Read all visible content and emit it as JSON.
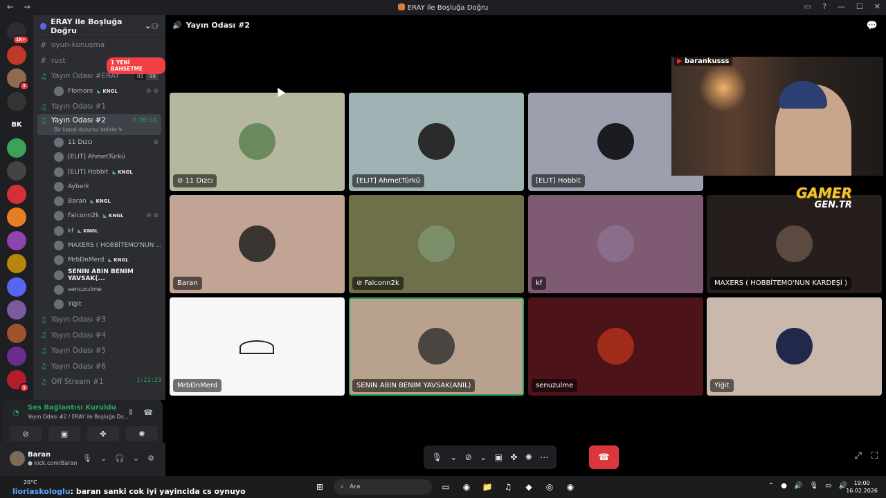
{
  "window": {
    "title": "ERAY ile Boşluğa Doğru",
    "nav_back": "←",
    "nav_forward": "→",
    "controls": [
      "▭",
      "?",
      "—",
      "☐",
      "✕"
    ]
  },
  "server": {
    "name": "ERAY ile Boşluğa Doğru",
    "mention_pill": "1 YENİ BAHSETME"
  },
  "guilds": [
    {
      "label": "",
      "badge": "1K+",
      "color": "#2b2d31"
    },
    {
      "label": "",
      "badge": "",
      "color": "#c0392b"
    },
    {
      "label": "",
      "badge": "1",
      "color": "#8e6b4e"
    },
    {
      "label": "",
      "badge": "",
      "color": "#333"
    },
    {
      "label": "BK",
      "badge": "",
      "color": "#1e1f22"
    },
    {
      "label": "",
      "badge": "",
      "color": "#3aa35a"
    },
    {
      "label": "",
      "badge": "",
      "color": "#444"
    },
    {
      "label": "",
      "badge": "",
      "color": "#d3303a"
    },
    {
      "label": "",
      "badge": "",
      "color": "#e67e22"
    },
    {
      "label": "",
      "badge": "",
      "color": "#8e44ad"
    },
    {
      "label": "",
      "badge": "",
      "color": "#b8860b"
    },
    {
      "label": "",
      "badge": "",
      "color": "#5865f2"
    },
    {
      "label": "",
      "badge": "",
      "color": "#7d5a9e"
    },
    {
      "label": "",
      "badge": "",
      "color": "#a0522d"
    },
    {
      "label": "",
      "badge": "",
      "color": "#6a2c91"
    },
    {
      "label": "",
      "badge": "1",
      "color": "#b21e2a"
    }
  ],
  "channels_top": [
    {
      "name": "oyun-konuşma",
      "sym": "#"
    },
    {
      "name": "rust",
      "sym": "#"
    }
  ],
  "voice_eray": {
    "name": "Yayın Odası #ERAY",
    "count_a": "01",
    "count_b": "99",
    "users": [
      {
        "name": "Flomore",
        "tag": "KNGL",
        "stat": "⊘ ⊘"
      }
    ]
  },
  "voice_1": {
    "name": "Yayın Odası #1"
  },
  "voice_2": {
    "name": "Yayın Odası #2",
    "timer": "3:56:16",
    "sub": "Bir kanal durumu belirle ✎",
    "users": [
      {
        "name": "11 Dızcı",
        "tag": "",
        "stat": "⊘"
      },
      {
        "name": "[ELIT] AhmetTürkü",
        "tag": "",
        "stat": ""
      },
      {
        "name": "[ELIT] Hobbit",
        "tag": "KNGL",
        "stat": ""
      },
      {
        "name": "Ayberk",
        "tag": "",
        "stat": ""
      },
      {
        "name": "Baran",
        "tag": "KNGL",
        "stat": ""
      },
      {
        "name": "Falconn2k",
        "tag": "KNGL",
        "stat": "⊘ ⊘"
      },
      {
        "name": "kf",
        "tag": "KNGL",
        "stat": ""
      },
      {
        "name": "MAXERS ( HOBBİTEMO'NUN ...",
        "tag": "",
        "stat": ""
      },
      {
        "name": "MrbÐnMerd",
        "tag": "KNGL",
        "stat": ""
      },
      {
        "name": "SENIN ABIN BENIM YAVSAK(...",
        "tag": "",
        "stat": "",
        "bold": true
      },
      {
        "name": "senuzulme",
        "tag": "",
        "stat": ""
      },
      {
        "name": "Yiğit",
        "tag": "",
        "stat": ""
      }
    ]
  },
  "channels_bottom": [
    {
      "name": "Yayın Odası #3"
    },
    {
      "name": "Yayın Odası #4"
    },
    {
      "name": "Yayın Odası #5"
    },
    {
      "name": "Yayın Odası #6"
    }
  ],
  "off_stream": {
    "name": "Off Stream #1",
    "timer": "1:21:29"
  },
  "voice_panel": {
    "status": "Ses Bağlantısı Kuruldu",
    "sub": "Yayın Odası #2 / ERAY ile Boşluğa Do...",
    "btn_icons": [
      "⊘",
      "▣",
      "✤",
      "✺"
    ]
  },
  "user": {
    "name": "Baran",
    "status": "● kick.com/Baran",
    "icons": [
      "🎙",
      "⌄",
      "🎧",
      "⌄",
      "⚙"
    ]
  },
  "main": {
    "channel_title": "Yayın Odası #2",
    "tiles": [
      {
        "name": "11 Dızcı",
        "icon": "⊘ ",
        "bg": "#b5b89f",
        "av": "#6a8a5e",
        "speaking": false
      },
      {
        "name": "[ELIT] AhmetTürkü",
        "icon": "",
        "bg": "#9fb3b5",
        "av": "#2b2b2b",
        "speaking": false
      },
      {
        "name": "[ELIT] Hobbit",
        "icon": "",
        "bg": "#9c9fad",
        "av": "#1a1c22",
        "speaking": false
      },
      {
        "name": "Baran",
        "icon": "",
        "bg": "#c2a495",
        "av": "#3a3531",
        "speaking": false
      },
      {
        "name": "Falconn2k",
        "icon": "⊘ ",
        "bg": "#6d7048",
        "av": "#7a8f6a",
        "speaking": false
      },
      {
        "name": "kf",
        "icon": "",
        "bg": "#7f5a73",
        "av": "#8a6d8a",
        "speaking": false
      },
      {
        "name": "MAXERS ( HOBBİTEMO'NUN KARDEŞİ )",
        "icon": "",
        "bg": "#251e1c",
        "av": "#5a4a40",
        "speaking": false
      },
      {
        "name": "MrbÐnMerd",
        "icon": "",
        "bg": "#f7f7f7",
        "av": "#f7f7f7",
        "speaking": false
      },
      {
        "name": "SENIN ABIN BENIM YAVSAK(ANIL)",
        "icon": "",
        "bg": "#b8a18d",
        "av": "#4a4540",
        "speaking": true
      },
      {
        "name": "senuzulme",
        "icon": "",
        "bg": "#4c1419",
        "av": "#a12c1a",
        "speaking": false
      },
      {
        "name": "Yiğit",
        "icon": "",
        "bg": "#c9b8ab",
        "av": "#1f2a4a",
        "speaking": false
      }
    ],
    "stream_handle": "barankusss",
    "gamer_logo": "GAMER",
    "gamer_sub": "GEN.TR",
    "controls": [
      "🎙",
      "⌄",
      "⊘",
      "⌄",
      "▣",
      "✤",
      "✺",
      "⋯"
    ],
    "hangup_icon": "☎",
    "corner_icons": [
      "⤢",
      "⛶"
    ],
    "chat_icon": "💬"
  },
  "taskbar": {
    "temp": "20°C",
    "ticker_name": "lioriaskologlu",
    "ticker_text": ": baran sanki cok iyi yayincida cs oynuyo",
    "search": "Ara",
    "time": "19:00",
    "date": "16.02.2026",
    "tray": [
      "⌃",
      "●",
      "🔊",
      "🎙",
      "▭",
      "🔊"
    ],
    "apps": [
      "⊞",
      "⌕",
      "▭",
      "◉",
      "📁",
      "♫",
      "◆",
      "◎",
      "◉"
    ]
  }
}
